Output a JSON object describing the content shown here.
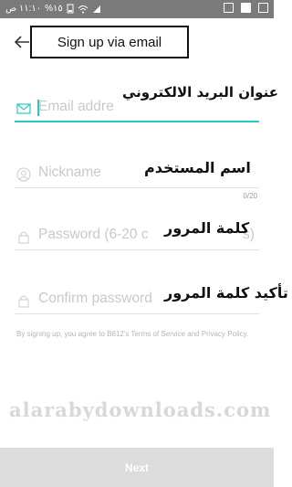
{
  "status_bar": {
    "time": "١١:١٠ ص",
    "battery": "%١٥"
  },
  "header": {
    "title": "Sign up via email"
  },
  "fields": [
    {
      "placeholder": "Email addre",
      "annotation": "عنوان البريد الالكتروني",
      "icon": "mail-icon"
    },
    {
      "placeholder": "Nickname",
      "annotation": "اسم المستخدم",
      "icon": "user-icon",
      "counter": "0/20"
    },
    {
      "placeholder": "Password (6-20 c",
      "placeholder_tail": "s)",
      "annotation": "كلمة المرور",
      "icon": "lock-icon"
    },
    {
      "placeholder": "Confirm password",
      "annotation": "تأكيد كلمة المرور",
      "icon": "lock-icon"
    }
  ],
  "terms": "By signing up, you agree to B612's Terms of Service and Privacy Policy.",
  "watermark": "alarabydownloads.com",
  "next_label": "Next",
  "colors": {
    "accent": "#2ec4c8",
    "status_bar": "#7a7a7a",
    "button_disabled": "#dcdcdc"
  }
}
